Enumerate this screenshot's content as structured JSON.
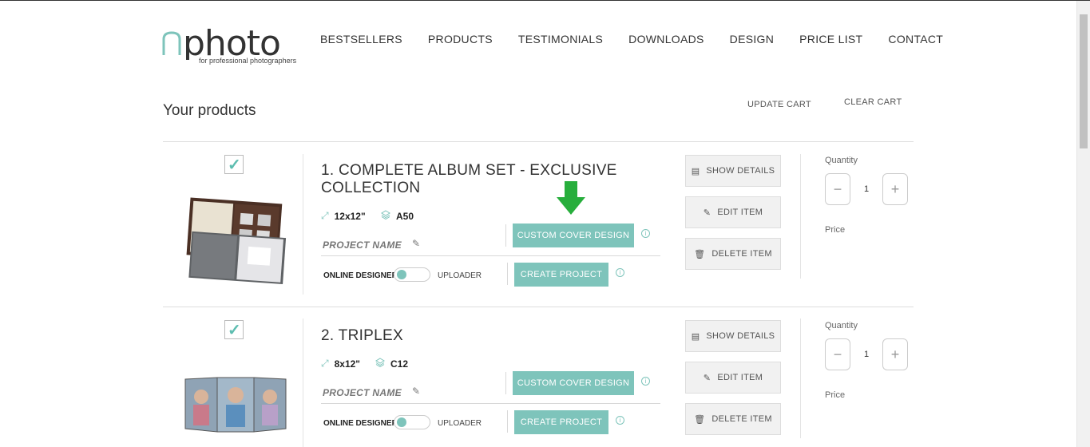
{
  "logo": {
    "text": "nphoto",
    "tagline": "for professional photographers"
  },
  "nav": [
    "BESTSELLERS",
    "PRODUCTS",
    "TESTIMONIALS",
    "DOWNLOADS",
    "DESIGN",
    "PRICE LIST",
    "CONTACT"
  ],
  "page_title": "Your products",
  "cart_actions": {
    "update": "UPDATE CART",
    "clear": "CLEAR CART"
  },
  "products": [
    {
      "title": "1. COMPLETE ALBUM SET - EXCLUSIVE COLLECTION",
      "size": "12x12\"",
      "paper": "A50",
      "project_name_label": "PROJECT NAME",
      "online_designer_label": "ONLINE DESIGNER",
      "uploader_label": "UPLOADER",
      "custom_cover_label": "CUSTOM COVER DESIGN",
      "create_project_label": "CREATE PROJECT",
      "show_details_label": "SHOW DETAILS",
      "edit_item_label": "EDIT ITEM",
      "delete_item_label": "DELETE ITEM",
      "quantity_label": "Quantity",
      "quantity": "1",
      "price_label": "Price"
    },
    {
      "title": "2. TRIPLEX",
      "size": "8x12\"",
      "paper": "C12",
      "project_name_label": "PROJECT NAME",
      "online_designer_label": "ONLINE DESIGNER",
      "uploader_label": "UPLOADER",
      "custom_cover_label": "CUSTOM COVER DESIGN",
      "create_project_label": "CREATE PROJECT",
      "show_details_label": "SHOW DETAILS",
      "edit_item_label": "EDIT ITEM",
      "delete_item_label": "DELETE ITEM",
      "quantity_label": "Quantity",
      "quantity": "1",
      "price_label": "Price"
    }
  ],
  "icons": {
    "checkmark": "✓",
    "resize": "⤢",
    "layers": "layers-icon",
    "pencil": "✎",
    "info": "i",
    "minus": "−",
    "plus": "+",
    "down_arrow": "arrow-down-icon"
  },
  "colors": {
    "accent": "#7ec4bb",
    "arrow": "#27ae3c"
  }
}
